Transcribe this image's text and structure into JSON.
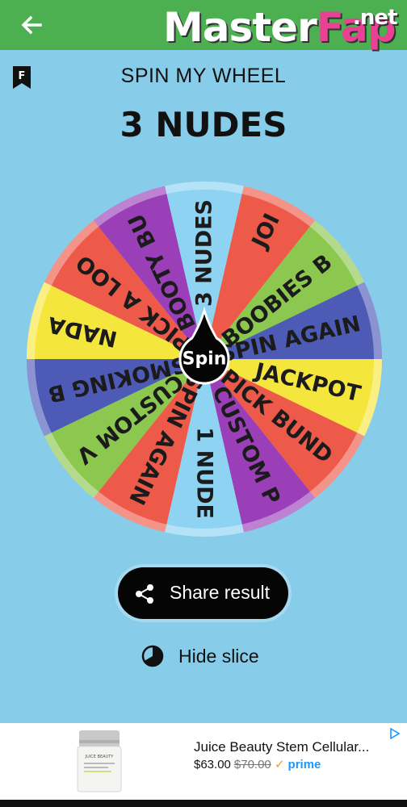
{
  "topbar": {
    "back_icon": "arrow-left-icon",
    "color": "#4caf50"
  },
  "watermark": {
    "part1": "Master",
    "part2": "Fap",
    "part3": ".net"
  },
  "header": {
    "flag_icon": "bookmark-f-icon",
    "flag_letter": "F",
    "title": "SPIN MY WHEEL"
  },
  "result": {
    "text": "3 NUDES"
  },
  "wheel": {
    "center_label": "Spin",
    "segments": [
      {
        "label": "3 NUDES",
        "color": "#8fd3f2"
      },
      {
        "label": "JOI",
        "color": "#ee5a4a"
      },
      {
        "label": "BOOBIES B",
        "color": "#8cc84f"
      },
      {
        "label": "SPIN AGAIN",
        "color": "#4d5bb6"
      },
      {
        "label": "JACKPOT",
        "color": "#f5e63e"
      },
      {
        "label": "PICK BUND",
        "color": "#ee5a4a"
      },
      {
        "label": "CUSTOM P",
        "color": "#9a3fb8"
      },
      {
        "label": "1 NUDE",
        "color": "#8fd3f2"
      },
      {
        "label": "SPIN AGAIN",
        "color": "#ee5a4a"
      },
      {
        "label": "CUSTOM V",
        "color": "#8cc84f"
      },
      {
        "label": "SMOKING B",
        "color": "#4d5bb6"
      },
      {
        "label": "NADA",
        "color": "#f5e63e"
      },
      {
        "label": "PICK A LOO",
        "color": "#ee5a4a"
      },
      {
        "label": "BOOTY BU",
        "color": "#9a3fb8"
      }
    ]
  },
  "share": {
    "label": "Share result",
    "icon": "share-icon"
  },
  "hide_slice": {
    "label": "Hide slice",
    "icon": "pie-chart-icon"
  },
  "ad": {
    "title": "Juice Beauty Stem Cellular...",
    "price": "$63.00",
    "old_price": "$70.00",
    "check": "✓",
    "prime": "prime",
    "adchoices_icon": "adchoices-icon",
    "product_brand": "JUICE BEAUTY"
  }
}
